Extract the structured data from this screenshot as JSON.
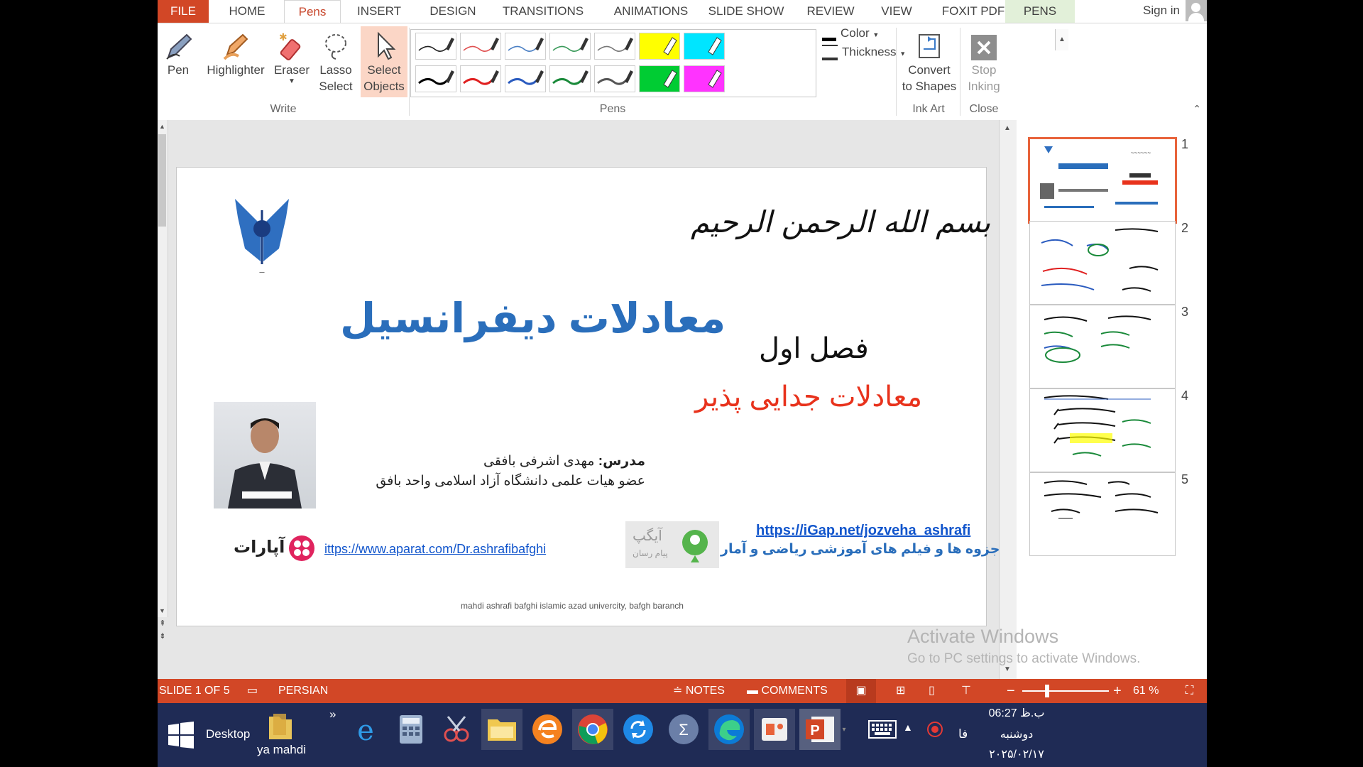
{
  "tabs": [
    {
      "label": "FILE"
    },
    {
      "label": "HOME"
    },
    {
      "label": "Pens"
    },
    {
      "label": "INSERT"
    },
    {
      "label": "DESIGN"
    },
    {
      "label": "TRANSITIONS"
    },
    {
      "label": "ANIMATIONS"
    },
    {
      "label": "SLIDE SHOW"
    },
    {
      "label": "REVIEW"
    },
    {
      "label": "VIEW"
    },
    {
      "label": "FOXIT PDF"
    },
    {
      "label": "PENS"
    }
  ],
  "signin": "Sign in",
  "ribbon": {
    "pen": "Pen",
    "highlighter": "Highlighter",
    "eraser": "Eraser",
    "lasso_line1": "Lasso",
    "lasso_line2": "Select",
    "select_line1": "Select",
    "select_line2": "Objects",
    "write_group": "Write",
    "pens_group": "Pens",
    "color": "Color",
    "thickness": "Thickness",
    "convert_line1": "Convert",
    "convert_line2": "to Shapes",
    "inkart_group": "Ink Art",
    "stop_line1": "Stop",
    "stop_line2": "Inking",
    "close_group": "Close",
    "pen_colors": [
      "#222222",
      "#e05050",
      "#4a7fc4",
      "#3a9a5a",
      "#777777",
      "#ffff00",
      "#00e5ff",
      "#000000",
      "#e02020",
      "#2a5bbf",
      "#1a8a3a",
      "#555555",
      "#00cc33",
      "#ff33ff"
    ]
  },
  "slide": {
    "bismillah": "بسم الله الرحمن الرحیم",
    "title": "معادلات دیفرانسیل",
    "chapter": "فصل اول",
    "subtitle": "معادلات جدایی پذیر",
    "teacher_label": "مدرس:",
    "teacher_name": "مهدی اشرفی بافقی",
    "teacher_role": "عضو هیات علمی دانشگاه آزاد اسلامی واحد بافق",
    "igap_url": "https://iGap.net/jozveha_ashrafi",
    "igap_desc": "جزوه ها و فیلم های آموزشی ریاضی و آمار",
    "aparat_url": "ittps://www.aparat.com/Dr.ashrafibafghi",
    "aparat_logo": "آپارات",
    "igap_logo": "آیگپ",
    "igap_logo_sub": "پیام رسان",
    "footer": "mahdi ashrafi bafghi  islamic azad univercity, bafgh baranch",
    "accent_blue": "#2a6ebb",
    "accent_red": "#e8321c"
  },
  "thumbnails": [
    {
      "num": "1"
    },
    {
      "num": "2"
    },
    {
      "num": "3"
    },
    {
      "num": "4"
    },
    {
      "num": "5"
    }
  ],
  "watermark": {
    "line1": "Activate Windows",
    "line2": "Go to PC settings to activate Windows."
  },
  "status": {
    "slide_info": "SLIDE 1 OF 5",
    "language": "PERSIAN",
    "notes": "NOTES",
    "comments": "COMMENTS",
    "zoom": "61 %",
    "zoom_percent": 61
  },
  "taskbar": {
    "desktop": "Desktop",
    "folder_label": "ya mahdi",
    "chevron": "»",
    "time": "06:27 ب.ظ",
    "day": "دوشنبه",
    "date": "۲۰۲۵/۰۲/۱۷",
    "lang": "فا"
  }
}
